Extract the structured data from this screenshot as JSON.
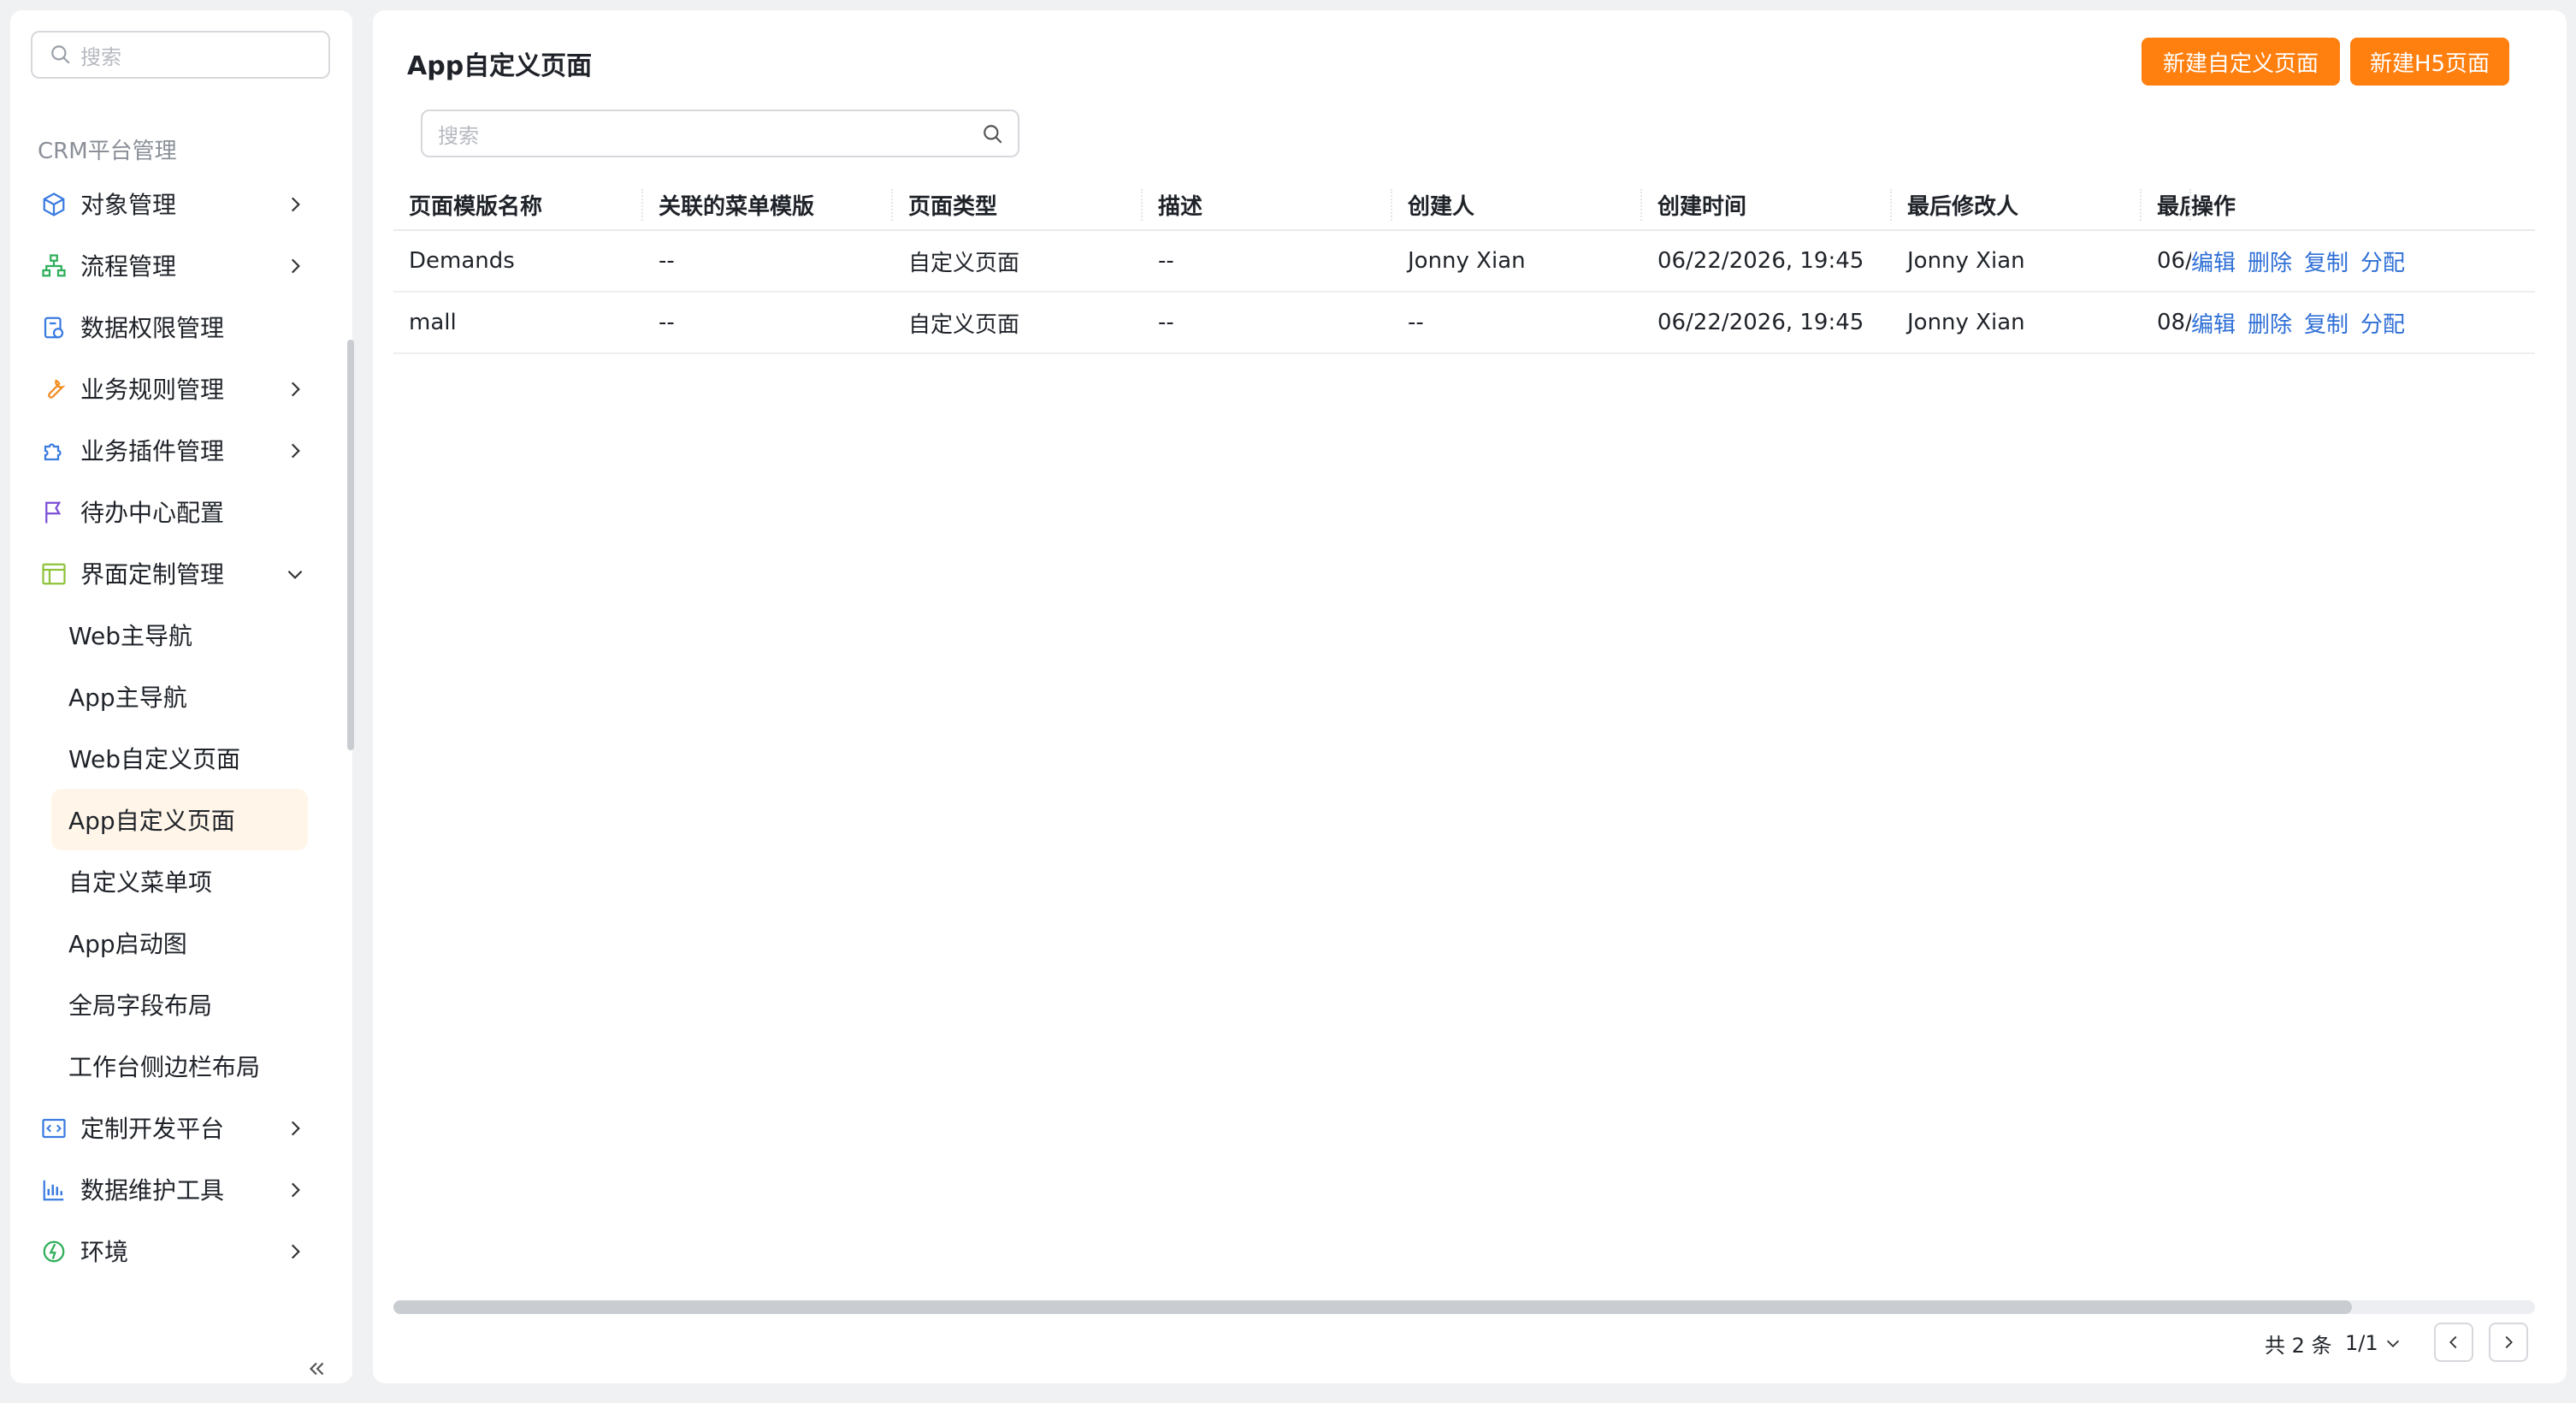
{
  "sidebar": {
    "search_placeholder": "搜索",
    "section_title": "CRM平台管理",
    "items": [
      {
        "label": "对象管理",
        "icon": "cube-icon",
        "chevron": "right"
      },
      {
        "label": "流程管理",
        "icon": "flow-icon",
        "chevron": "right"
      },
      {
        "label": "数据权限管理",
        "icon": "data-permission-icon",
        "chevron": ""
      },
      {
        "label": "业务规则管理",
        "icon": "wrench-icon",
        "chevron": "right"
      },
      {
        "label": "业务插件管理",
        "icon": "puzzle-icon",
        "chevron": "right"
      },
      {
        "label": "待办中心配置",
        "icon": "flag-icon",
        "chevron": ""
      },
      {
        "label": "界面定制管理",
        "icon": "window-icon",
        "chevron": "down"
      }
    ],
    "subitems": [
      "Web主导航",
      "App主导航",
      "Web自定义页面",
      "App自定义页面",
      "自定义菜单项",
      "App启动图",
      "全局字段布局",
      "工作台侧边栏布局"
    ],
    "active_subitem": "App自定义页面",
    "bottom_items": [
      {
        "label": "定制开发平台",
        "icon": "code-icon"
      },
      {
        "label": "数据维护工具",
        "icon": "bar-chart-icon"
      },
      {
        "label": "环境",
        "icon": "environment-icon"
      }
    ]
  },
  "main": {
    "title": "App自定义页面",
    "btn_new_custom": "新建自定义页面",
    "btn_new_h5": "新建H5页面",
    "search_placeholder": "搜索",
    "columns": [
      "页面模版名称",
      "关联的菜单模版",
      "页面类型",
      "描述",
      "创建人",
      "创建时间",
      "最后修改人",
      "最后",
      "操作"
    ],
    "rows": [
      [
        "Demands",
        "--",
        "自定义页面",
        "--",
        "Jonny Xian",
        "06/22/2026, 19:45",
        "Jonny Xian",
        "06/2"
      ],
      [
        "mall",
        "--",
        "自定义页面",
        "--",
        "--",
        "06/22/2026, 19:45",
        "Jonny Xian",
        "08/1"
      ]
    ],
    "actions": [
      "编辑",
      "删除",
      "复制",
      "分配"
    ],
    "pagination": {
      "total": "共 2 条",
      "page": "1/1"
    }
  },
  "colors": {
    "accent": "#ff7f0f",
    "link": "#2f6fd6",
    "active_bg": "#fff6e9"
  }
}
